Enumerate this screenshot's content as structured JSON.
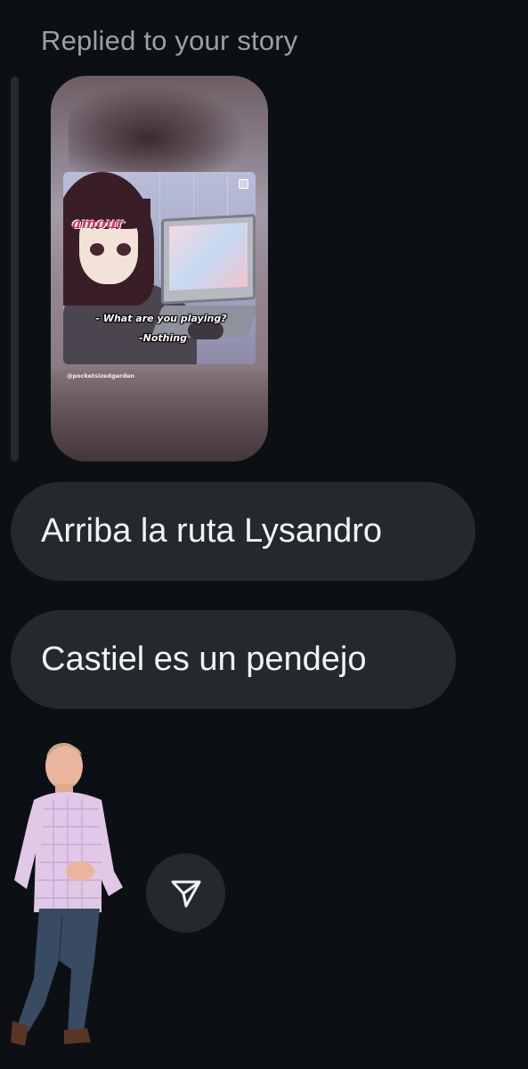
{
  "reply": {
    "label": "Replied to your story"
  },
  "story": {
    "caption_question": "- What are you playing?",
    "caption_answer": "-Nothing",
    "game_logo_text": "amour",
    "watermark": "@pocketsizedgarden"
  },
  "messages": [
    {
      "text": "Arriba la ruta Lysandro"
    },
    {
      "text": "Castiel es un pendejo"
    }
  ],
  "sticker": {
    "icon": "man-sticker-icon"
  },
  "actions": {
    "send_icon": "paper-plane-icon"
  },
  "colors": {
    "background": "#0c1014",
    "bubble": "#25292d",
    "text": "#f2f3f5",
    "muted": "#9aa0a6"
  }
}
